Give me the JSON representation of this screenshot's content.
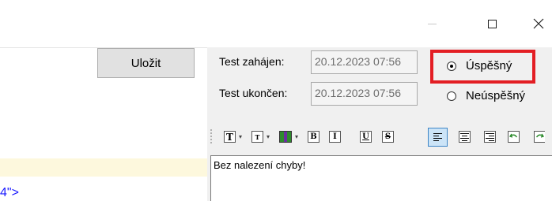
{
  "window": {
    "minimize_icon": "minimize-icon",
    "maximize_icon": "maximize-icon",
    "close_icon": "close-icon"
  },
  "form": {
    "save_label": "Uložit",
    "start_label": "Test zahájen:",
    "start_value": "20.12.2023 07:56",
    "end_label": "Test ukončen:",
    "end_value": "20.12.2023 07:56"
  },
  "result": {
    "success_label": "Úspěšný",
    "failure_label": "Neúspěšný",
    "selected": "Úspěšný",
    "highlight_color": "#e31e24"
  },
  "toolbar": {
    "font_icon": "T",
    "font_size_icon": "T",
    "bold": "B",
    "italic": "I",
    "underline": "U",
    "strike": "S",
    "active_button": "align-left"
  },
  "editor": {
    "text": "Bez nalezení chyby!"
  },
  "background_snippet": "4\">"
}
